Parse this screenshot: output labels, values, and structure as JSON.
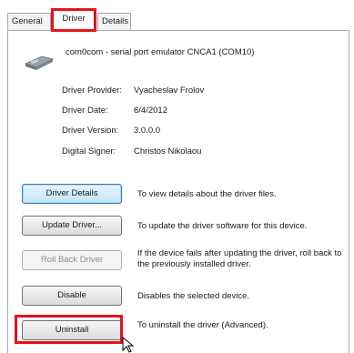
{
  "tabs": {
    "general": "General",
    "driver": "Driver",
    "details": "Details"
  },
  "device": {
    "name": "com0com - serial port emulator CNCA1 (COM10)"
  },
  "info": {
    "provider_label": "Driver Provider:",
    "provider_value": "Vyacheslav Frolov",
    "date_label": "Driver Date:",
    "date_value": "6/4/2012",
    "version_label": "Driver Version:",
    "version_value": "3.0.0.0",
    "signer_label": "Digital Signer:",
    "signer_value": "Christos Nikolaou"
  },
  "actions": {
    "details": {
      "label": "Driver Details",
      "desc": "To view details about the driver files."
    },
    "update": {
      "label": "Update Driver...",
      "desc": "To update the driver software for this device."
    },
    "rollback": {
      "label": "Roll Back Driver",
      "desc": "If the device fails after updating the driver, roll back to the previously installed driver."
    },
    "disable": {
      "label": "Disable",
      "desc": "Disables the selected device."
    },
    "uninstall": {
      "label": "Uninstall",
      "desc": "To uninstall the driver (Advanced)."
    }
  },
  "colors": {
    "highlight": "#e4121d",
    "focus_border": "#3c7fb1"
  },
  "icons": {
    "device": "serial-connector-icon",
    "cursor": "mouse-pointer-icon"
  }
}
